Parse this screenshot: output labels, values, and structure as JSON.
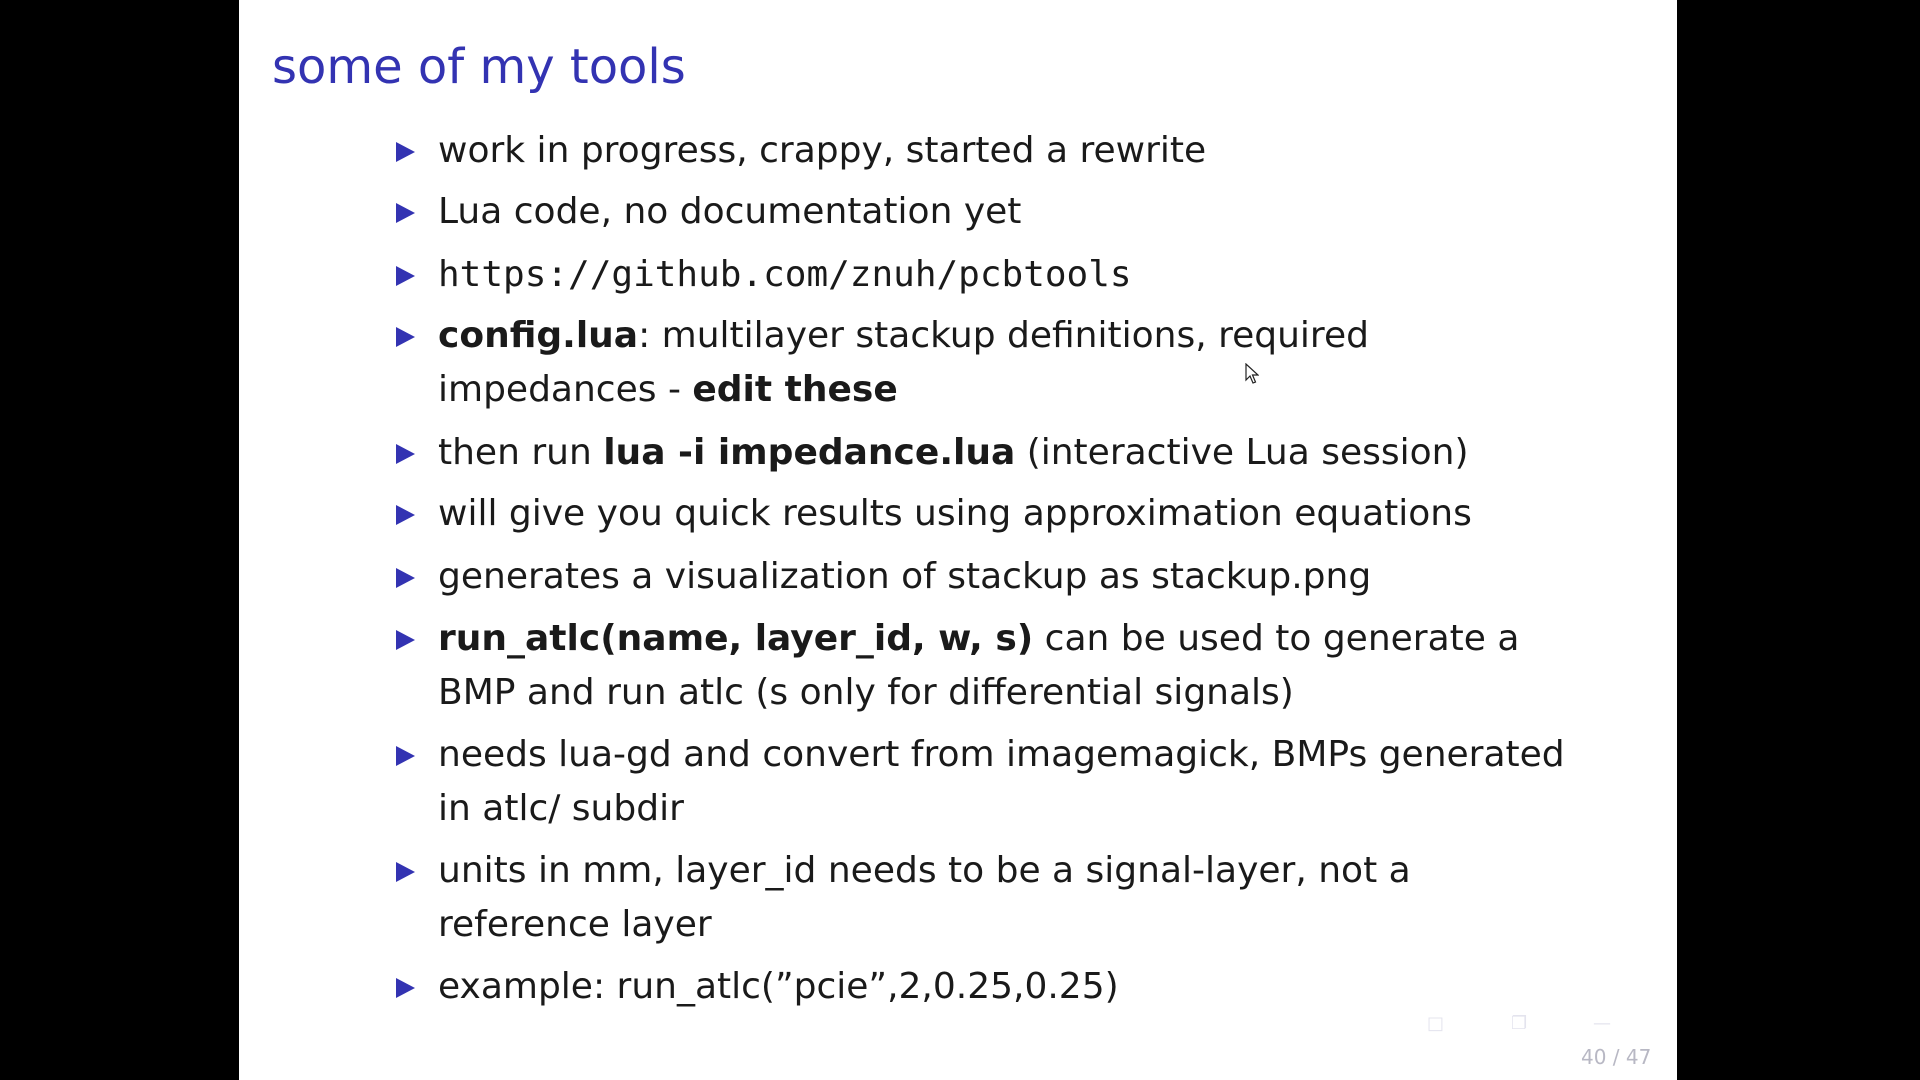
{
  "slide": {
    "title": "some of my tools",
    "bullets": [
      {
        "text": "work in progress, crappy, started a rewrite"
      },
      {
        "text": "Lua code, no documentation yet"
      },
      {
        "url": "https://github.com/znuh/pcbtools"
      },
      {
        "bold": "config.lua",
        "rest": ": multilayer stackup definitions, required",
        "line2": "impedances - ",
        "line2_bold": "edit these"
      },
      {
        "prefix": "then run ",
        "bold": "lua -i impedance.lua",
        "rest": " (interactive Lua session)"
      },
      {
        "text": "will give you quick results using approximation equations"
      },
      {
        "text": "generates a visualization of stackup as stackup.png"
      },
      {
        "bold": "run_atlc(name, layer_id, w, s)",
        "rest": " can be used to generate a",
        "line2": "BMP and run atlc (s only for differential signals)"
      },
      {
        "text": "needs lua-gd and convert from imagemagick, BMPs generated",
        "line2": "in atlc/ subdir"
      },
      {
        "text": "units in mm, layer_id needs to be a signal-layer, not a",
        "line2": "reference layer"
      },
      {
        "text": "example: run_atlc(”pcie”,2,0.25,0.25)"
      }
    ],
    "page_number": "40 / 47"
  },
  "nav_icons": [
    "frame-nav-icon",
    "subsection-nav-icon",
    "section-nav-icon",
    "presentation-nav-icon",
    "appendix-nav-icon",
    "back-icon",
    "search-icon",
    "forward-icon"
  ],
  "colors": {
    "background": "#000000",
    "slide": "#ffffff",
    "title": "#3333b2",
    "bullet": "#3333b2",
    "text": "#1a1a1a"
  }
}
